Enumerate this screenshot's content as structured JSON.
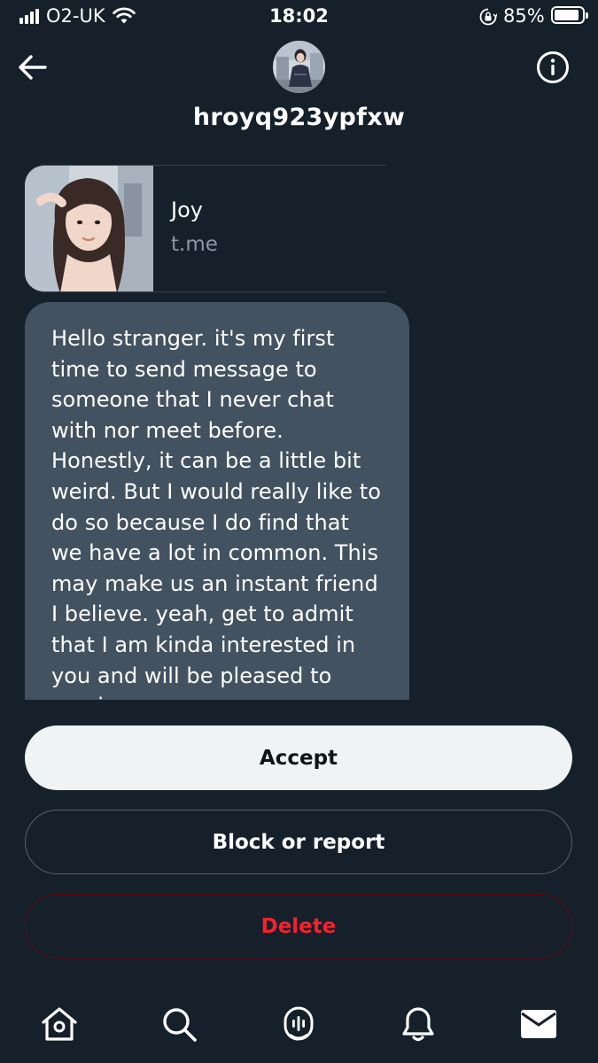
{
  "status_bar": {
    "carrier": "O2-UK",
    "time": "18:02",
    "battery_percent": "85%",
    "battery_level": 0.85,
    "icons": [
      "signal-icon",
      "wifi-icon",
      "orientation-lock-icon",
      "battery-icon"
    ]
  },
  "header": {
    "username": "hroyq923ypfxw",
    "icons": [
      "back-arrow-icon",
      "info-icon"
    ]
  },
  "link_card": {
    "title": "Joy",
    "domain": "t.me"
  },
  "message": {
    "text": "Hello stranger. it's my first time to send message to someone that I never chat with nor meet before. Honestly, it can be a little bit weird. But I would really like to do so because I do find that we have a lot in common. This may make us an instant friend I believe. yeah, get to admit that I am kinda interested in you and will be pleased to receive your"
  },
  "actions": {
    "accept": "Accept",
    "block_report": "Block or report",
    "delete": "Delete"
  },
  "bottom_nav": {
    "icons": [
      "home-icon",
      "search-icon",
      "spaces-icon",
      "notifications-icon",
      "messages-icon"
    ]
  },
  "colors": {
    "background": "#15202b",
    "bubble": "#435261",
    "accept_bg": "#eff3f4",
    "delete_text": "#f4212e",
    "muted_text": "#8b98a5"
  }
}
